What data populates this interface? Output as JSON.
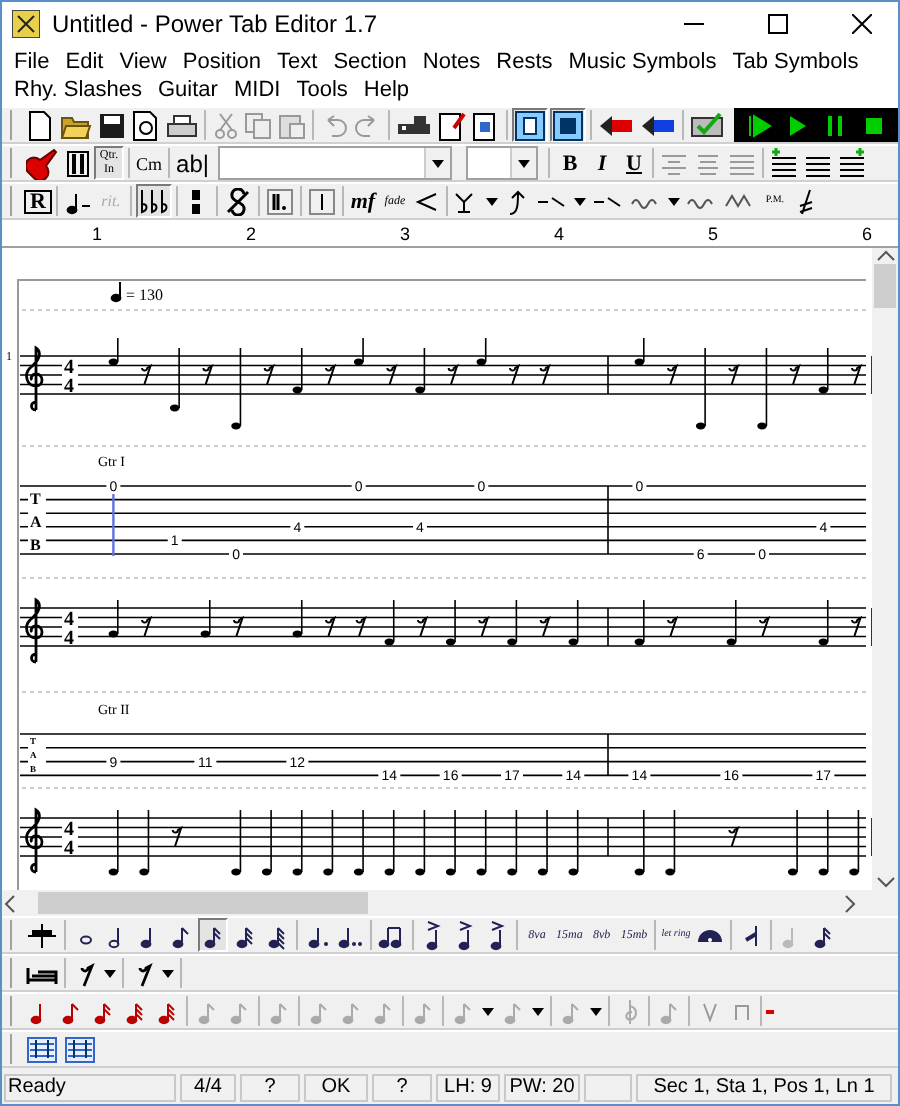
{
  "window": {
    "title": "Untitled - Power Tab Editor 1.7"
  },
  "menu": {
    "items": [
      "File",
      "Edit",
      "View",
      "Position",
      "Text",
      "Section",
      "Notes",
      "Rests",
      "Music Symbols",
      "Tab Symbols",
      "Rhy. Slashes",
      "Guitar",
      "MIDI",
      "Tools",
      "Help"
    ]
  },
  "main_toolbar": {
    "view_buttons": [
      {
        "pressed": true
      },
      {
        "pressed": true
      }
    ]
  },
  "format_toolbar": {
    "quarter_lines": [
      "Qtr.",
      "In"
    ],
    "chord": "Cm",
    "text": "ab|",
    "bold": "B",
    "italic": "I",
    "underline": "U"
  },
  "symbol_toolbar": {
    "rehearsal": "R",
    "ritardando": "rit.",
    "dynamic": "mf",
    "fade": "fade",
    "palm_mute": "P.M."
  },
  "ruler": {
    "marks": [
      "1",
      "2",
      "3",
      "4",
      "5",
      "6"
    ]
  },
  "score": {
    "systems": [
      {
        "number": "1",
        "tempo": "= 130",
        "time_signature": [
          "4",
          "4"
        ],
        "guitar": "Gtr I",
        "tab_label": [
          "T",
          "A",
          "B"
        ],
        "kind": "six_string",
        "measures": [
          {
            "slots": [
              {
                "kind": "note",
                "s1": "0"
              },
              {
                "kind": "rest"
              },
              {
                "kind": "note",
                "s5": "1"
              },
              {
                "kind": "rest"
              },
              {
                "kind": "note",
                "s6": "0"
              },
              {
                "kind": "rest"
              },
              {
                "kind": "note",
                "s4": "4"
              },
              {
                "kind": "rest"
              },
              {
                "kind": "note",
                "s1": "0"
              },
              {
                "kind": "rest"
              },
              {
                "kind": "note",
                "s4": "4"
              },
              {
                "kind": "rest"
              },
              {
                "kind": "note",
                "s1": "0"
              },
              {
                "kind": "rest"
              },
              {
                "kind": "rest"
              }
            ]
          },
          {
            "slots": [
              {
                "kind": "note",
                "s1": "0"
              },
              {
                "kind": "rest"
              },
              {
                "kind": "note",
                "s6": "6"
              },
              {
                "kind": "rest"
              },
              {
                "kind": "note",
                "s6": "0"
              },
              {
                "kind": "rest"
              },
              {
                "kind": "note",
                "s4": "4"
              },
              {
                "kind": "rest"
              }
            ]
          }
        ]
      },
      {
        "time_signature": [
          "4",
          "4"
        ],
        "guitar": "Gtr II",
        "tab_label": [
          "T",
          "A",
          "B"
        ],
        "kind": "four_string",
        "measures": [
          {
            "slots": [
              {
                "kind": "note",
                "s3": "9"
              },
              {
                "kind": "rest"
              },
              {
                "kind": "blank"
              },
              {
                "kind": "note",
                "s3": "11"
              },
              {
                "kind": "rest"
              },
              {
                "kind": "blank"
              },
              {
                "kind": "note",
                "s3": "12"
              },
              {
                "kind": "rest"
              },
              {
                "kind": "rest"
              },
              {
                "kind": "note",
                "s4": "14"
              },
              {
                "kind": "rest"
              },
              {
                "kind": "note",
                "s4": "16"
              },
              {
                "kind": "rest"
              },
              {
                "kind": "note",
                "s4": "17"
              },
              {
                "kind": "rest"
              },
              {
                "kind": "note",
                "s4": "14"
              }
            ]
          },
          {
            "slots": [
              {
                "kind": "note",
                "s4": "14"
              },
              {
                "kind": "rest"
              },
              {
                "kind": "blank"
              },
              {
                "kind": "note",
                "s4": "16"
              },
              {
                "kind": "rest"
              },
              {
                "kind": "blank"
              },
              {
                "kind": "note",
                "s4": "17"
              },
              {
                "kind": "rest"
              }
            ]
          }
        ]
      },
      {
        "time_signature": [
          "4",
          "4"
        ],
        "measures": [
          {
            "slots": [
              {
                "kind": "note"
              },
              {
                "kind": "note"
              },
              {
                "kind": "rest"
              },
              {
                "kind": "blank"
              },
              {
                "kind": "note"
              },
              {
                "kind": "note"
              },
              {
                "kind": "note"
              },
              {
                "kind": "note"
              },
              {
                "kind": "note"
              },
              {
                "kind": "note"
              },
              {
                "kind": "note"
              },
              {
                "kind": "note"
              },
              {
                "kind": "note"
              },
              {
                "kind": "note"
              },
              {
                "kind": "note"
              },
              {
                "kind": "note"
              }
            ]
          },
          {
            "slots": [
              {
                "kind": "note"
              },
              {
                "kind": "note"
              },
              {
                "kind": "blank"
              },
              {
                "kind": "rest"
              },
              {
                "kind": "blank"
              },
              {
                "kind": "note"
              },
              {
                "kind": "note"
              },
              {
                "kind": "note"
              }
            ]
          }
        ]
      }
    ]
  },
  "duration_toolbar": {
    "durations": [
      {
        "selected": false
      },
      {
        "selected": false
      },
      {
        "selected": false
      },
      {
        "selected": false
      },
      {
        "selected": true
      },
      {
        "selected": false
      },
      {
        "selected": false
      }
    ],
    "octave_labels": [
      "8va",
      "15ma",
      "8vb",
      "15mb"
    ],
    "let_ring": "let ring"
  },
  "status_bar": {
    "panes": [
      "Ready",
      "4/4",
      "?",
      "OK",
      "?",
      "LH: 9",
      "PW: 20"
    ],
    "position": "Sec 1, Sta 1, Pos 1, Ln 1"
  }
}
